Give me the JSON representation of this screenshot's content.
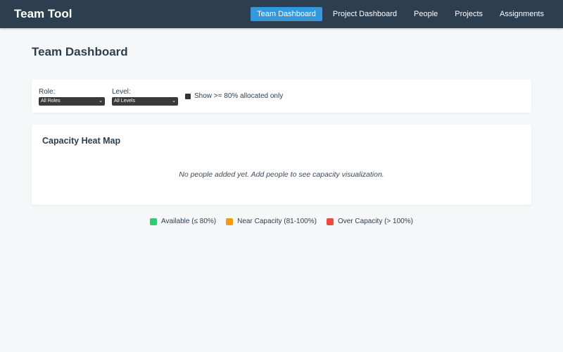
{
  "app": {
    "title": "Team Tool"
  },
  "nav": {
    "items": [
      {
        "label": "Team Dashboard",
        "active": true
      },
      {
        "label": "Project Dashboard",
        "active": false
      },
      {
        "label": "People",
        "active": false
      },
      {
        "label": "Projects",
        "active": false
      },
      {
        "label": "Assignments",
        "active": false
      }
    ]
  },
  "page": {
    "title": "Team Dashboard"
  },
  "filters": {
    "role": {
      "label": "Role:",
      "value": "All Roles"
    },
    "level": {
      "label": "Level:",
      "value": "All Levels"
    },
    "allocated_only": {
      "label": "Show >= 80% allocated only",
      "checked": false
    }
  },
  "heatmap": {
    "title": "Capacity Heat Map",
    "empty_message": "No people added yet. Add people to see capacity visualization."
  },
  "legend": [
    {
      "label": "Available (≤ 80%)",
      "color": "#2ecc71"
    },
    {
      "label": "Near Capacity (81-100%)",
      "color": "#f39c12"
    },
    {
      "label": "Over Capacity (> 100%)",
      "color": "#e74c3c"
    }
  ]
}
